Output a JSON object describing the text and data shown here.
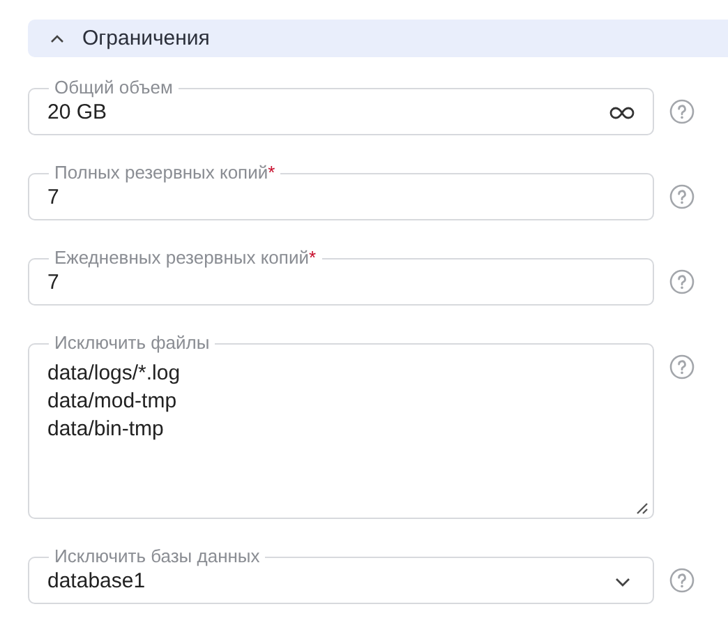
{
  "section": {
    "title": "Ограничения",
    "expanded": true
  },
  "fields": [
    {
      "kind": "infinite",
      "label": "Общий объем",
      "value": "20 GB"
    },
    {
      "kind": "input",
      "label": "Полных резервных копий",
      "required_mark": "*",
      "value": "7"
    },
    {
      "kind": "input",
      "label": "Ежедневных резервных копий",
      "required_mark": "*",
      "value": "7"
    },
    {
      "kind": "textarea",
      "label": "Исключить файлы",
      "lines": [
        "data/logs/*.log",
        "data/mod-tmp",
        "data/bin-tmp"
      ]
    },
    {
      "kind": "select",
      "label": "Исключить базы данных",
      "value": "database1"
    }
  ]
}
